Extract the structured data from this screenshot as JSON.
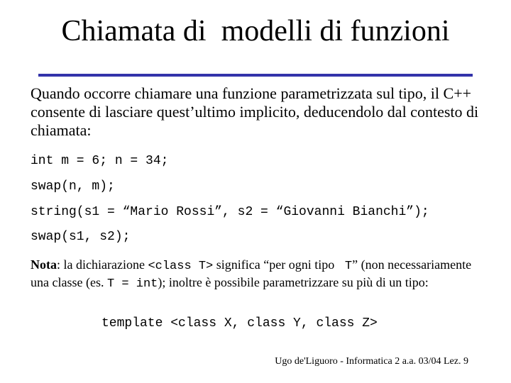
{
  "slide": {
    "title": "Chiamata di  modelli di funzioni",
    "accent_color": "#3333aa",
    "intro": "Quando occorre chiamare una funzione parametrizzata sul tipo, il C++ consente di lasciare quest’ultimo implicito, deducendolo dal contesto di chiamata:",
    "code_lines": [
      "int m = 6; n = 34;",
      "swap(n, m);",
      "string(s1 = “Mario Rossi”, s2 = “Giovanni Bianchi”);",
      "swap(s1, s2);"
    ],
    "note": {
      "label": "Nota",
      "part1": ": la dichiarazione ",
      "code1": "<class T>",
      "part2": " significa “per ogni tipo ",
      "code2": " T",
      "part3": "” (non necessariamente una classe (es. ",
      "code3": "T = int",
      "part4": "); inoltre è possibile parametrizzare su più di un tipo:"
    },
    "template_line": "template <class X, class Y, class Z>",
    "footer": "Ugo de'Liguoro - Informatica 2 a.a. 03/04 Lez. 9"
  }
}
